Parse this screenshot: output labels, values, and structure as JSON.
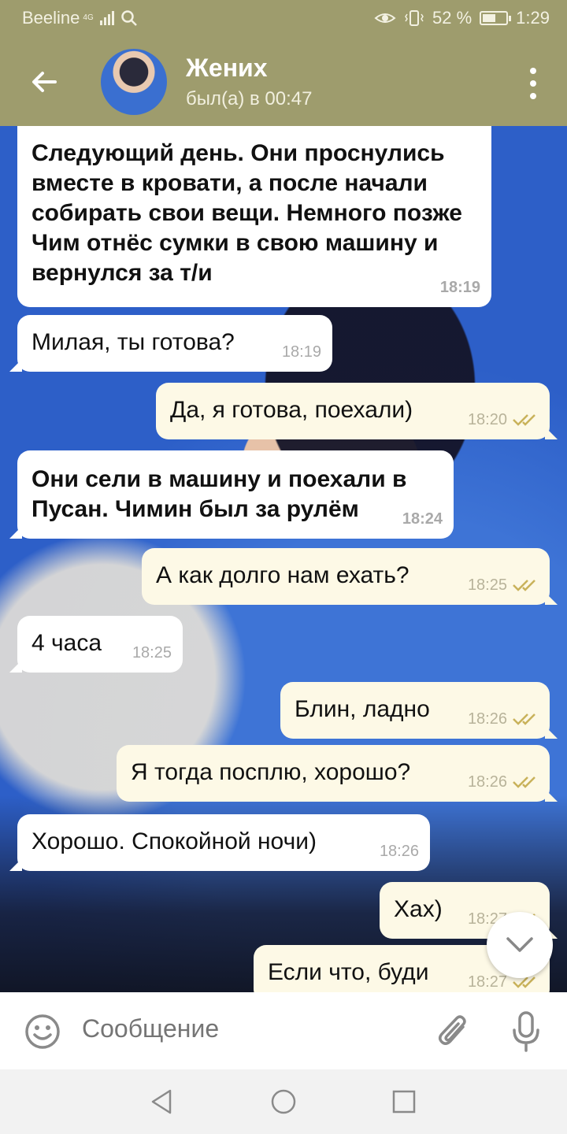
{
  "status_bar": {
    "carrier": "Beeline",
    "network": "4G",
    "battery": "52 %",
    "time": "1:29"
  },
  "header": {
    "title": "Жених",
    "subtitle": "был(а) в 00:47"
  },
  "messages": [
    {
      "dir": "in",
      "bold": true,
      "text": "Следующий день. Они проснулись вместе в кровати, а после начали собирать свои вещи. Немного позже Чим отнёс сумки в свою машину и вернулся за т/и",
      "time": "18:19"
    },
    {
      "dir": "in",
      "bold": false,
      "text": "Милая, ты готова?",
      "time": "18:19"
    },
    {
      "dir": "out",
      "text": "Да, я готова, поехали)",
      "time": "18:20"
    },
    {
      "dir": "in",
      "bold": true,
      "text": "Они сели в машину и поехали в Пусан. Чимин был за рулём",
      "time": "18:24"
    },
    {
      "dir": "out",
      "text": "А как долго нам ехать?",
      "time": "18:25"
    },
    {
      "dir": "in",
      "bold": false,
      "text": "4 часа",
      "time": "18:25"
    },
    {
      "dir": "out",
      "text": "Блин, ладно",
      "time": "18:26"
    },
    {
      "dir": "out",
      "text": "Я тогда посплю, хорошо?",
      "time": "18:26"
    },
    {
      "dir": "in",
      "bold": false,
      "text": "Хорошо. Спокойной ночи)",
      "time": "18:26"
    },
    {
      "dir": "out",
      "text": "Хах)",
      "time": "18:27"
    },
    {
      "dir": "out",
      "text": "Если что, буди",
      "time": "18:27"
    }
  ],
  "input": {
    "placeholder": "Сообщение"
  },
  "icons": {
    "back": "arrow-left-icon",
    "menu": "kebab-menu-icon",
    "emoji": "smiley-icon",
    "attach": "paperclip-icon",
    "mic": "microphone-icon",
    "scroll_down": "chevron-down-icon"
  },
  "colors": {
    "header_bg": "#9e9c6d",
    "incoming_bubble": "#ffffff",
    "outgoing_bubble": "#fdf9e6",
    "read_ticks": "#c9b25a"
  }
}
